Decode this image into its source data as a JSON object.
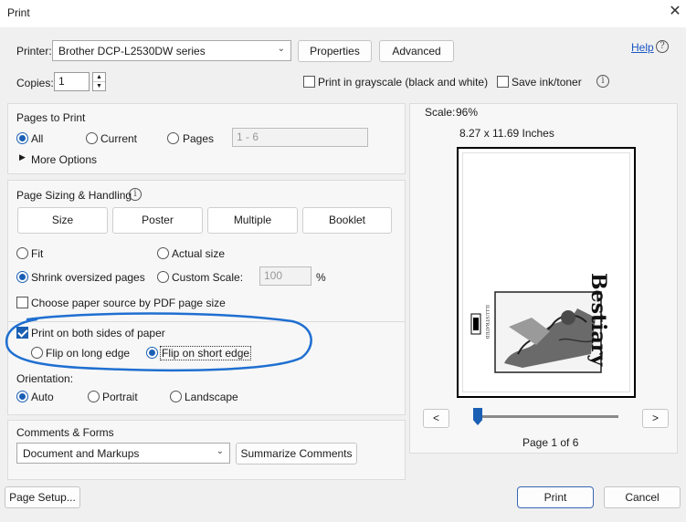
{
  "window": {
    "title": "Print",
    "close_icon": "close-icon"
  },
  "printer": {
    "label": "Printer:",
    "selected": "Brother DCP-L2530DW series",
    "properties_label": "Properties",
    "advanced_label": "Advanced",
    "help_label": "Help"
  },
  "copies": {
    "label": "Copies:",
    "value": "1",
    "grayscale_label": "Print in grayscale (black and white)",
    "grayscale_checked": false,
    "save_ink_label": "Save ink/toner",
    "save_ink_checked": false
  },
  "pages_to_print": {
    "title": "Pages to Print",
    "all_label": "All",
    "current_label": "Current",
    "pages_label": "Pages",
    "pages_value": "1 - 6",
    "selected": "All",
    "more_options_label": "More Options"
  },
  "sizing": {
    "title": "Page Sizing & Handling",
    "tabs": [
      "Size",
      "Poster",
      "Multiple",
      "Booklet"
    ],
    "fit_label": "Fit",
    "actual_size_label": "Actual size",
    "shrink_label": "Shrink oversized pages",
    "custom_scale_label": "Custom Scale:",
    "custom_scale_value": "100",
    "percent_sign": "%",
    "selected": "Shrink oversized pages",
    "paper_source_label": "Choose paper source by PDF page size",
    "paper_source_checked": false,
    "both_sides_label": "Print on both sides of paper",
    "both_sides_checked": true,
    "flip_long_label": "Flip on long edge",
    "flip_short_label": "Flip on short edge",
    "flip_selected": "Flip on short edge"
  },
  "orientation": {
    "title": "Orientation:",
    "auto_label": "Auto",
    "portrait_label": "Portrait",
    "landscape_label": "Landscape",
    "selected": "Auto"
  },
  "comments": {
    "title": "Comments & Forms",
    "selected": "Document and Markups",
    "summarize_label": "Summarize Comments"
  },
  "preview": {
    "scale_label": "Scale:",
    "scale_value": "96%",
    "paper_size": "8.27 x 11.69 Inches",
    "book_title": "Bestiary",
    "prev_label": "<",
    "next_label": ">",
    "page_indicator": "Page 1 of 6",
    "page_fraction": 0.0
  },
  "footer": {
    "page_setup_label": "Page Setup...",
    "print_label": "Print",
    "cancel_label": "Cancel"
  },
  "annotation": {
    "color": "#1f6fd1"
  }
}
